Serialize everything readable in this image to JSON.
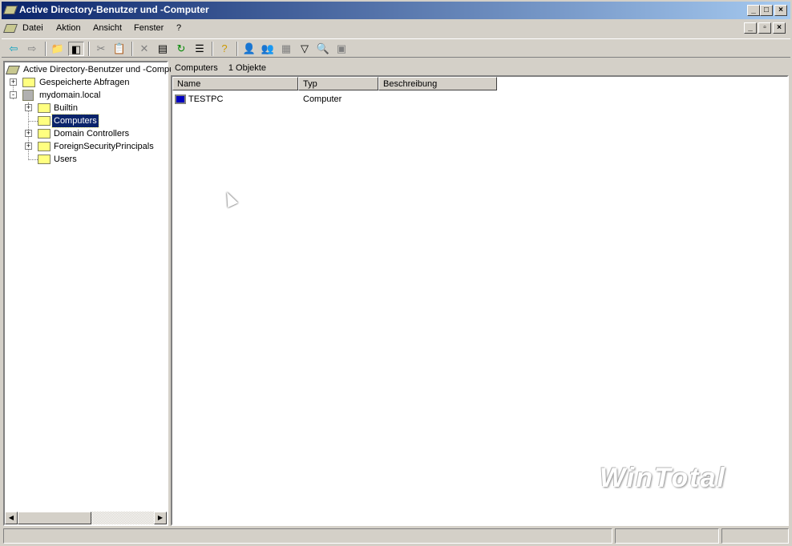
{
  "window": {
    "title": "Active Directory-Benutzer und -Computer",
    "controls": [
      "_",
      "□",
      "×"
    ],
    "child_controls": [
      "_",
      "▫",
      "×"
    ]
  },
  "menu": [
    {
      "label": "Datei"
    },
    {
      "label": "Aktion"
    },
    {
      "label": "Ansicht"
    },
    {
      "label": "Fenster"
    },
    {
      "label": "?"
    }
  ],
  "toolbar": [
    "back-icon",
    "forward-icon",
    "up-folder-icon",
    "show-hide-tree-icon",
    "cut-icon",
    "paste-icon",
    "delete-icon",
    "properties-icon",
    "refresh-icon",
    "export-list-icon",
    "help-icon",
    "new-user-icon",
    "new-group-icon",
    "new-ou-icon",
    "filter-icon",
    "find-icon",
    "add-to-group-icon"
  ],
  "tree": {
    "root": "Active Directory-Benutzer und -Computer",
    "items": [
      {
        "label": "Gespeicherte Abfragen",
        "expander": "+"
      },
      {
        "label": "mydomain.local",
        "expander": "-"
      },
      {
        "label": "Builtin",
        "expander": "+"
      },
      {
        "label": "Computers",
        "selected": true
      },
      {
        "label": "Domain Controllers",
        "expander": "+"
      },
      {
        "label": "ForeignSecurityPrincipals",
        "expander": "+"
      },
      {
        "label": "Users"
      }
    ]
  },
  "details": {
    "container": "Computers",
    "count": "1 Objekte",
    "columns": [
      "Name",
      "Typ",
      "Beschreibung"
    ],
    "rows": [
      {
        "name": "TESTPC",
        "type": "Computer",
        "description": ""
      }
    ]
  },
  "watermark": "WinTotal",
  "colors": {
    "title_start": "#0a246a",
    "title_end": "#a6caf0",
    "selection": "#0a246a"
  }
}
